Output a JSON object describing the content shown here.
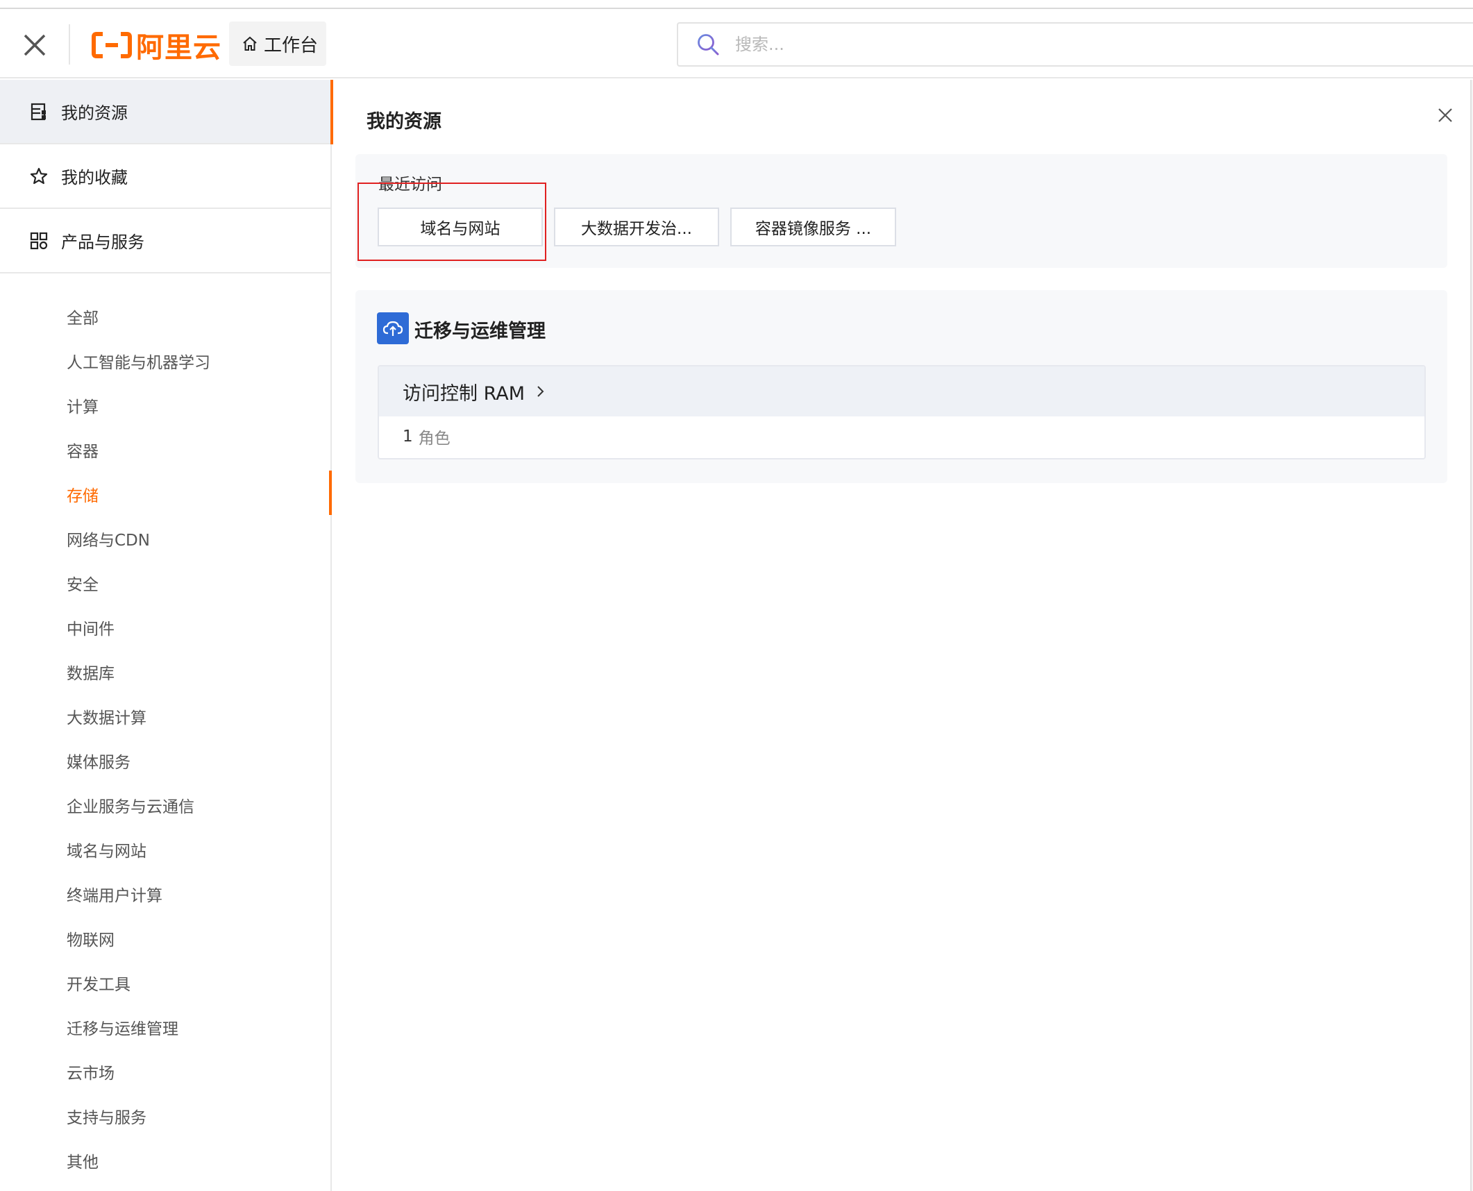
{
  "header": {
    "logo_text": "阿里云",
    "workbench_label": "工作台",
    "search_placeholder": "搜索..."
  },
  "sidebar": {
    "main_items": [
      {
        "label": "我的资源"
      },
      {
        "label": "我的收藏"
      },
      {
        "label": "产品与服务"
      }
    ],
    "categories": [
      "全部",
      "人工智能与机器学习",
      "计算",
      "容器",
      "存储",
      "网络与CDN",
      "安全",
      "中间件",
      "数据库",
      "大数据计算",
      "媒体服务",
      "企业服务与云通信",
      "域名与网站",
      "终端用户计算",
      "物联网",
      "开发工具",
      "迁移与运维管理",
      "云市场",
      "支持与服务",
      "其他"
    ],
    "active_category": "存储"
  },
  "panel": {
    "title": "我的资源",
    "recent": {
      "title": "最近访问",
      "items": [
        "域名与网站",
        "大数据开发治...",
        "容器镜像服务 ..."
      ]
    },
    "group": {
      "title": "迁移与运维管理",
      "card": {
        "title": "访问控制 RAM",
        "count": "1",
        "unit": "角色"
      }
    }
  },
  "colors": {
    "accent": "#ff6a00",
    "highlight_box": "#e02020",
    "group_icon": "#2e6bd6"
  }
}
